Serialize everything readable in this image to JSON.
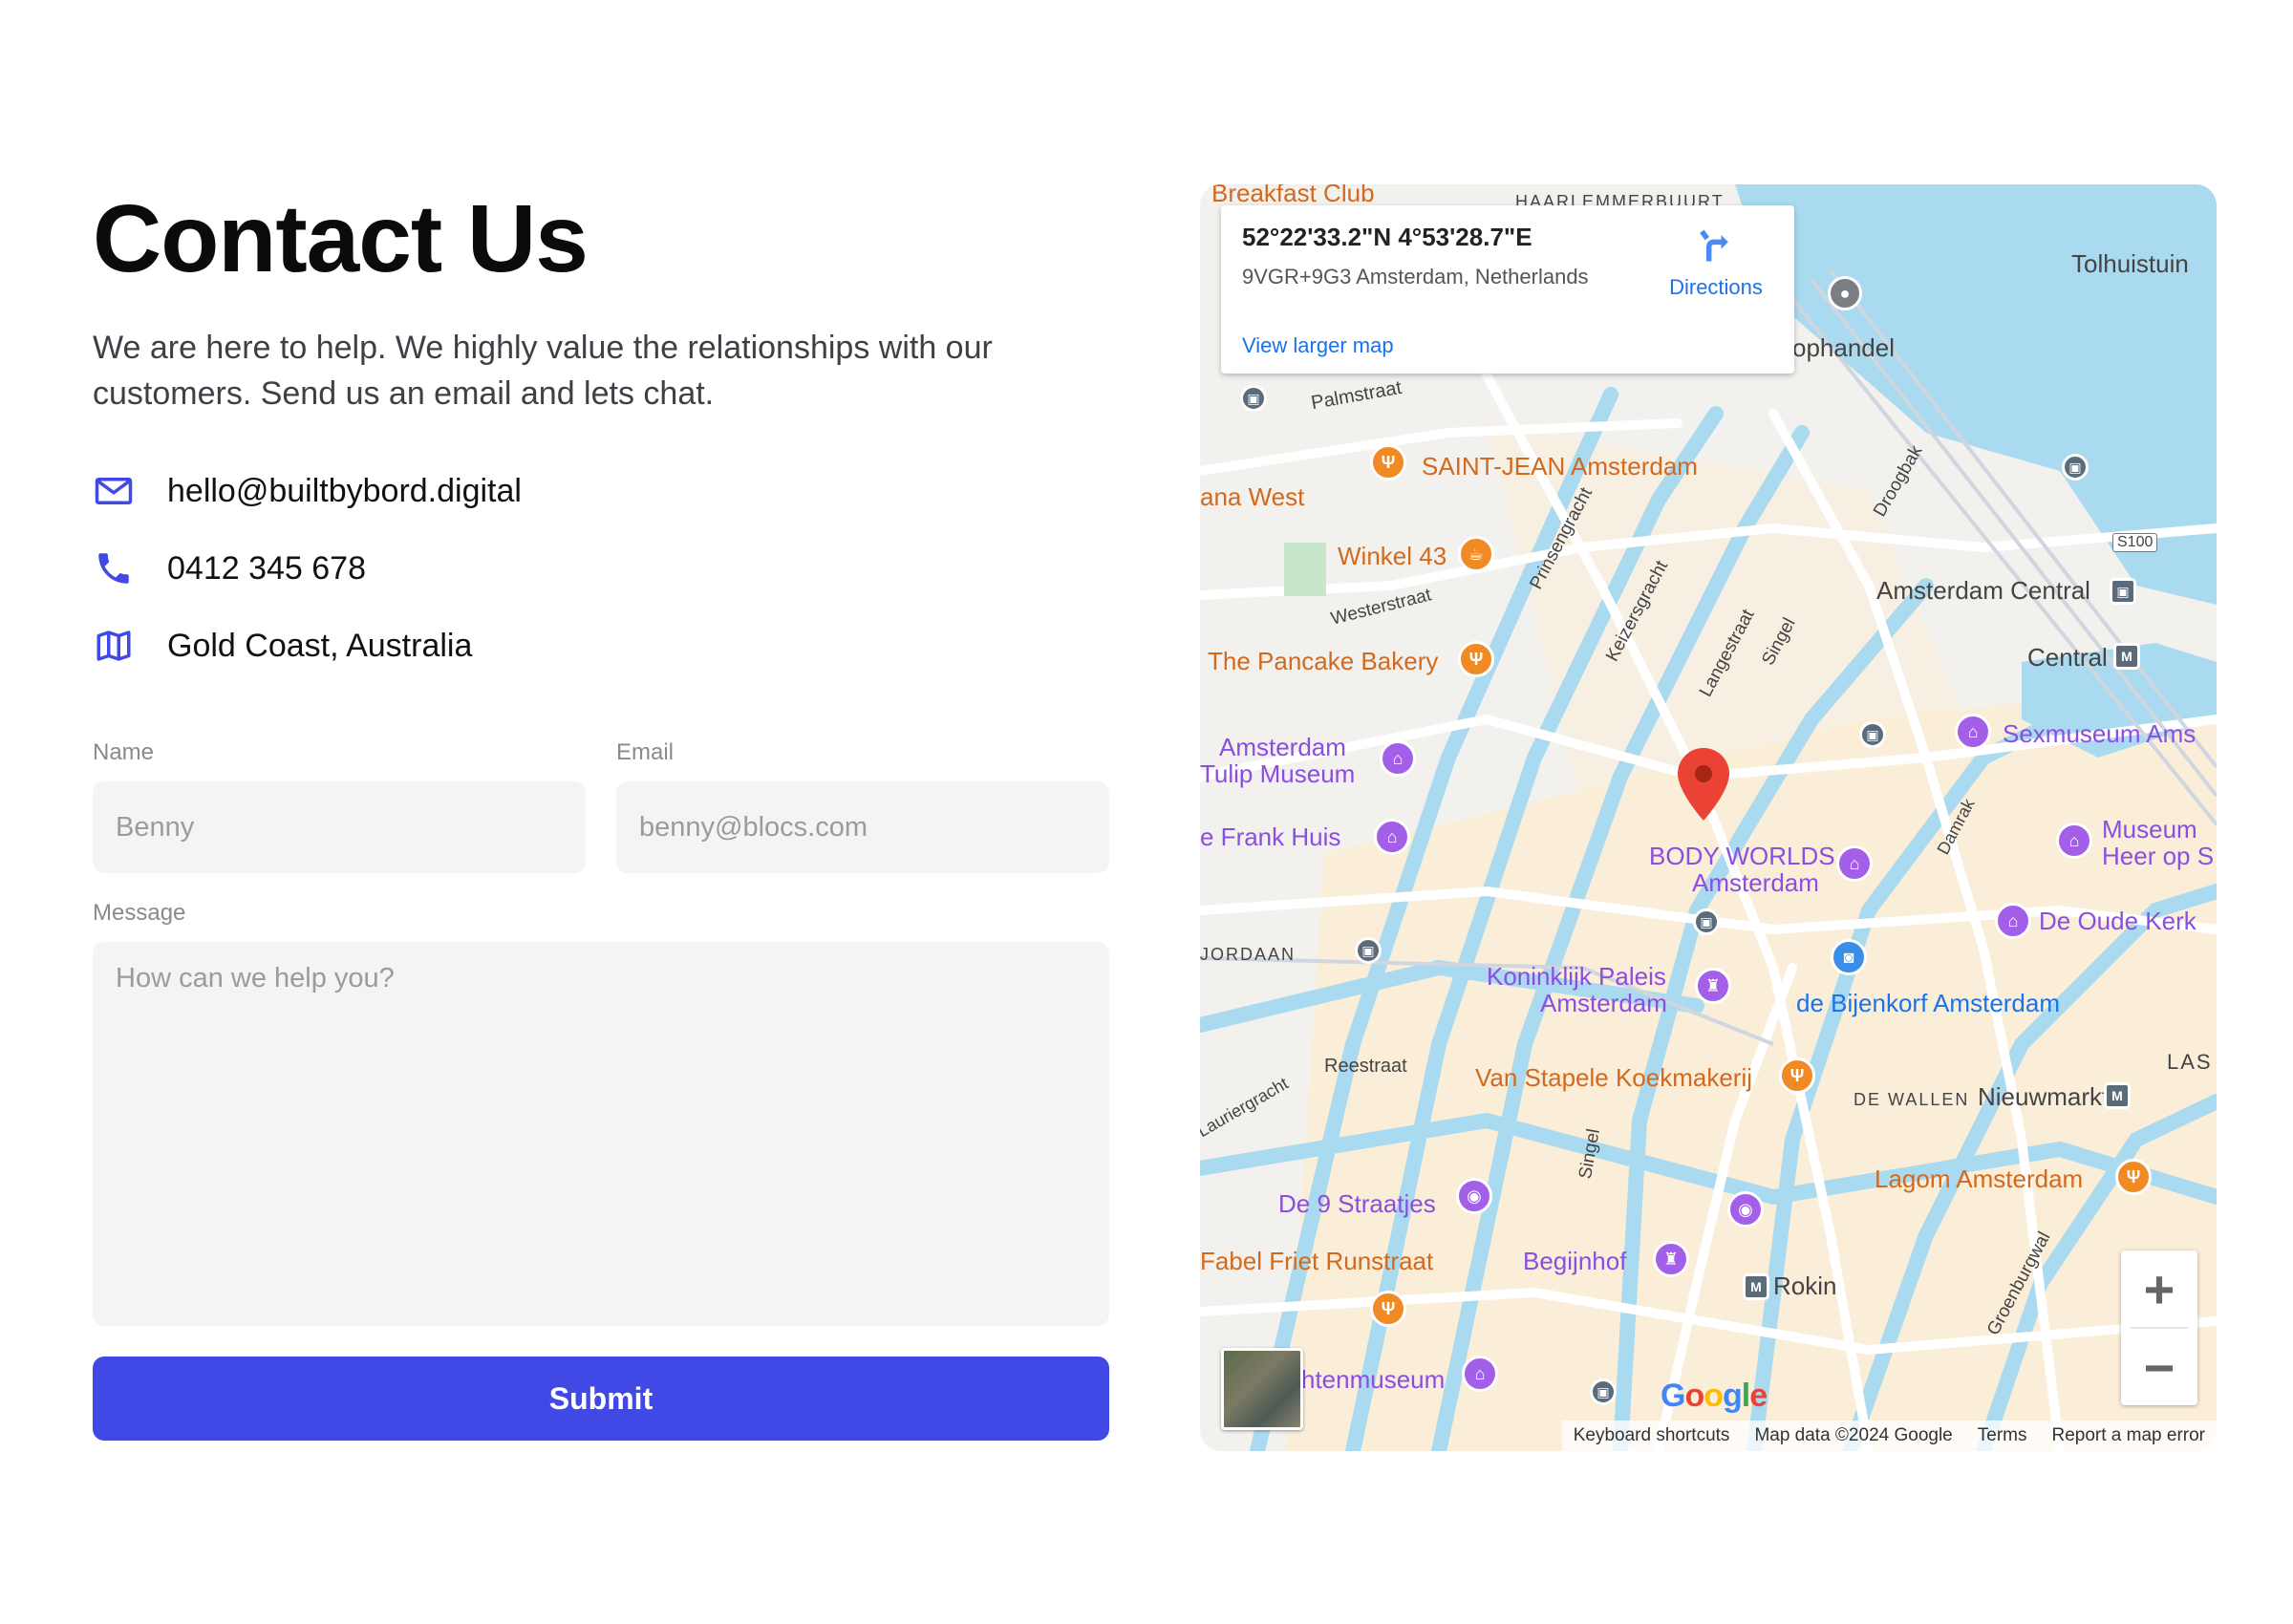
{
  "page": {
    "title": "Contact Us",
    "intro": "We are here to help. We highly value the relationships with our customers. Send us an email and lets chat."
  },
  "contact": {
    "email": "hello@builtbybord.digital",
    "phone": "0412 345 678",
    "location": "Gold Coast, Australia",
    "icons": [
      "envelope-icon",
      "phone-icon",
      "map-icon"
    ],
    "accent": "#4049e6"
  },
  "form": {
    "name_label": "Name",
    "name_placeholder": "Benny",
    "email_label": "Email",
    "email_placeholder": "benny@blocs.com",
    "message_label": "Message",
    "message_placeholder": "How can we help you?",
    "submit_label": "Submit",
    "submit_color": "#4049e6"
  },
  "map": {
    "coordinates": "52°22'33.2\"N 4°53'28.7\"E",
    "plus_code": "9VGR+9G3 Amsterdam, Netherlands",
    "directions_label": "Directions",
    "larger_map_label": "View larger map",
    "zoom_in": "+",
    "zoom_out": "−",
    "footer": {
      "shortcuts": "Keyboard shortcuts",
      "map_data": "Map data ©2024 Google",
      "terms": "Terms",
      "report": "Report a map error"
    },
    "logo_text": "Google",
    "places": {
      "breakfast": "Breakfast Club",
      "haarlem": "HAARLEMMERBUURT",
      "tolhuistuin": "Tolhuistuin",
      "kophandel": "ophandel",
      "palmstraat": "Palmstraat",
      "saint_jean": "SAINT-JEAN Amsterdam",
      "ana_west": "ana West",
      "winkel": "Winkel 43",
      "droogbak": "Droogbak",
      "s100": "S100",
      "prinsengracht": "Prinsengracht",
      "westerstraat": "Westerstraat",
      "amsterdam_central": "Amsterdam Central",
      "keizersgracht": "Keizersgracht",
      "pancake": "The Pancake Bakery",
      "central": "Central",
      "langestraat": "Langestraat",
      "singel": "Singel",
      "tulip1": "Amsterdam",
      "tulip2": "Tulip Museum",
      "sexmuseum": "Sexmuseum Ams",
      "frank": "e Frank Huis",
      "body1": "BODY WORLDS",
      "body2": "Amsterdam",
      "damrak": "Damrak",
      "museum_heer1": "Museum",
      "museum_heer2": "Heer op S",
      "oude_kerk": "De Oude Kerk",
      "jordaan": "JORDAAN",
      "paleis1": "Koninklijk Paleis",
      "paleis2": "Amsterdam",
      "bijenkorf": "de Bijenkorf Amsterdam",
      "reestraat": "Reestraat",
      "van_stapele": "Van Stapele Koekmakerij",
      "las": "LAS",
      "de_wallen": "DE WALLEN",
      "nieuwmarkt": "Nieuwmarkt",
      "lauriergracht": "Lauriergracht",
      "singel2": "Singel",
      "lagom": "Lagom Amsterdam",
      "straatjes": "De 9 Straatjes",
      "fabel": "Fabel Friet Runstraat",
      "begijnhof": "Begijnhof",
      "rokin": "Rokin",
      "groenburgwal": "Groenburgwal",
      "tenmuseum": "htenmuseum"
    },
    "colors": {
      "water": "#aadaef",
      "road": "#ffffff",
      "land": "#f2f1ee",
      "district": "#fbeed3",
      "pin": "#ea4335"
    }
  }
}
